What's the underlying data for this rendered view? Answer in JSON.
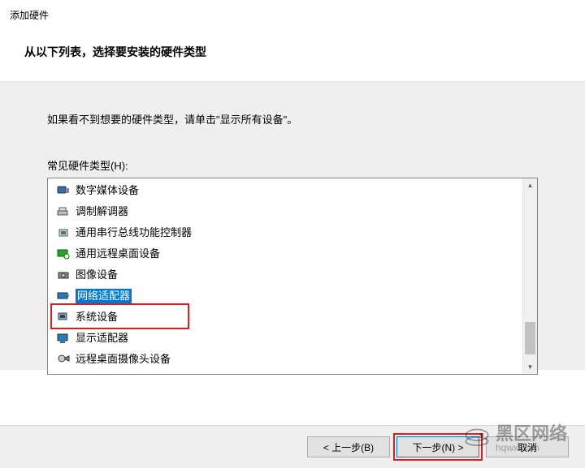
{
  "window_title": "添加硬件",
  "heading": "从以下列表，选择要安装的硬件类型",
  "instruction": "如果看不到想要的硬件类型，请单击\"显示所有设备\"。",
  "list_label": "常见硬件类型(H):",
  "items": [
    {
      "icon": "media-device-icon",
      "label": "数字媒体设备"
    },
    {
      "icon": "modem-icon",
      "label": "调制解调器"
    },
    {
      "icon": "usb-controller-icon",
      "label": "通用串行总线功能控制器"
    },
    {
      "icon": "remote-desktop-icon",
      "label": "通用远程桌面设备"
    },
    {
      "icon": "imaging-device-icon",
      "label": "图像设备"
    },
    {
      "icon": "network-adapter-icon",
      "label": "网络适配器",
      "selected": true
    },
    {
      "icon": "system-device-icon",
      "label": "系统设备"
    },
    {
      "icon": "display-adapter-icon",
      "label": "显示适配器"
    },
    {
      "icon": "rd-camera-icon",
      "label": "远程桌面摄像头设备"
    }
  ],
  "buttons": {
    "back": "< 上一步(B)",
    "next": "下一步(N) >",
    "cancel": "取消"
  },
  "watermark": {
    "text": "黑区网络",
    "domain": "hqwx.com"
  }
}
